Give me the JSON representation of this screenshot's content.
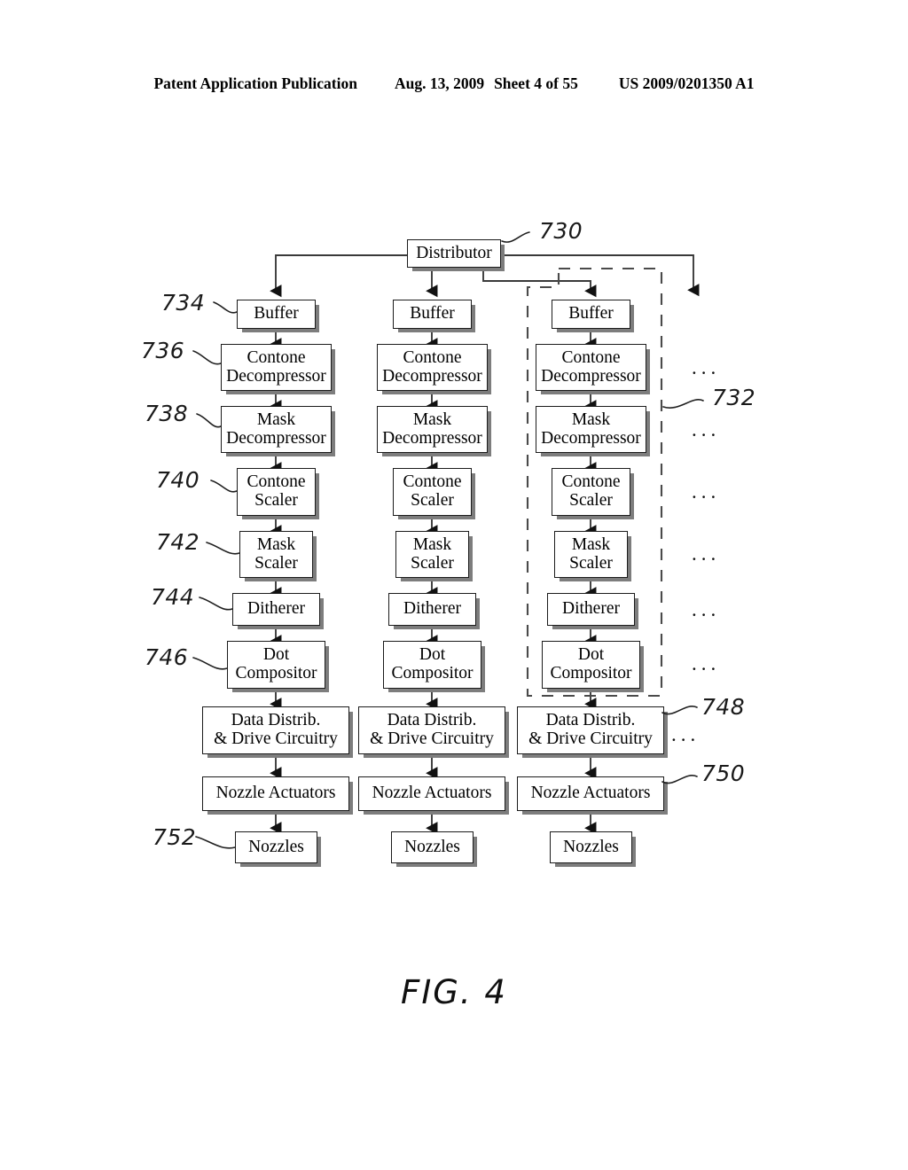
{
  "header": {
    "publication": "Patent Application Publication",
    "date": "Aug. 13, 2009",
    "sheet": "Sheet 4 of 55",
    "patent_number": "US 2009/0201350 A1"
  },
  "figure": {
    "caption": "FIG. 4",
    "distributor_label": "Distributor",
    "ellipsis": "...",
    "rows": [
      {
        "key": "buffer",
        "label": "Buffer"
      },
      {
        "key": "contone_decomp",
        "label": "Contone\nDecompressor"
      },
      {
        "key": "mask_decomp",
        "label": "Mask\nDecompressor"
      },
      {
        "key": "contone_scaler",
        "label": "Contone\nScaler"
      },
      {
        "key": "mask_scaler",
        "label": "Mask\nScaler"
      },
      {
        "key": "ditherer",
        "label": "Ditherer"
      },
      {
        "key": "dot_comp",
        "label": "Dot\nCompositor"
      },
      {
        "key": "data_distrib",
        "label": "Data Distrib.\n& Drive Circuitry"
      },
      {
        "key": "nozzle_act",
        "label": "Nozzle Actuators"
      },
      {
        "key": "nozzles",
        "label": "Nozzles"
      }
    ],
    "reference_numerals": [
      {
        "id": "730",
        "value": "730",
        "target": "distributor"
      },
      {
        "id": "732",
        "value": "732",
        "target": "print-engine-pipeline-group"
      },
      {
        "id": "734",
        "value": "734",
        "target": "buffer"
      },
      {
        "id": "736",
        "value": "736",
        "target": "contone-decompressor"
      },
      {
        "id": "738",
        "value": "738",
        "target": "mask-decompressor"
      },
      {
        "id": "740",
        "value": "740",
        "target": "contone-scaler"
      },
      {
        "id": "742",
        "value": "742",
        "target": "mask-scaler"
      },
      {
        "id": "744",
        "value": "744",
        "target": "ditherer"
      },
      {
        "id": "746",
        "value": "746",
        "target": "dot-compositor"
      },
      {
        "id": "748",
        "value": "748",
        "target": "data-distrib-and-drive-circuitry"
      },
      {
        "id": "750",
        "value": "750",
        "target": "nozzle-actuators"
      },
      {
        "id": "752",
        "value": "752",
        "target": "nozzles"
      }
    ],
    "columns": [
      {
        "index": 0,
        "name": "column-1"
      },
      {
        "index": 1,
        "name": "column-2"
      },
      {
        "index": 2,
        "name": "column-3"
      }
    ]
  },
  "colors": {
    "ink": "#000000",
    "line": "#1b1b1b",
    "shadow": "#7d7d7d",
    "paper": "#ffffff"
  }
}
